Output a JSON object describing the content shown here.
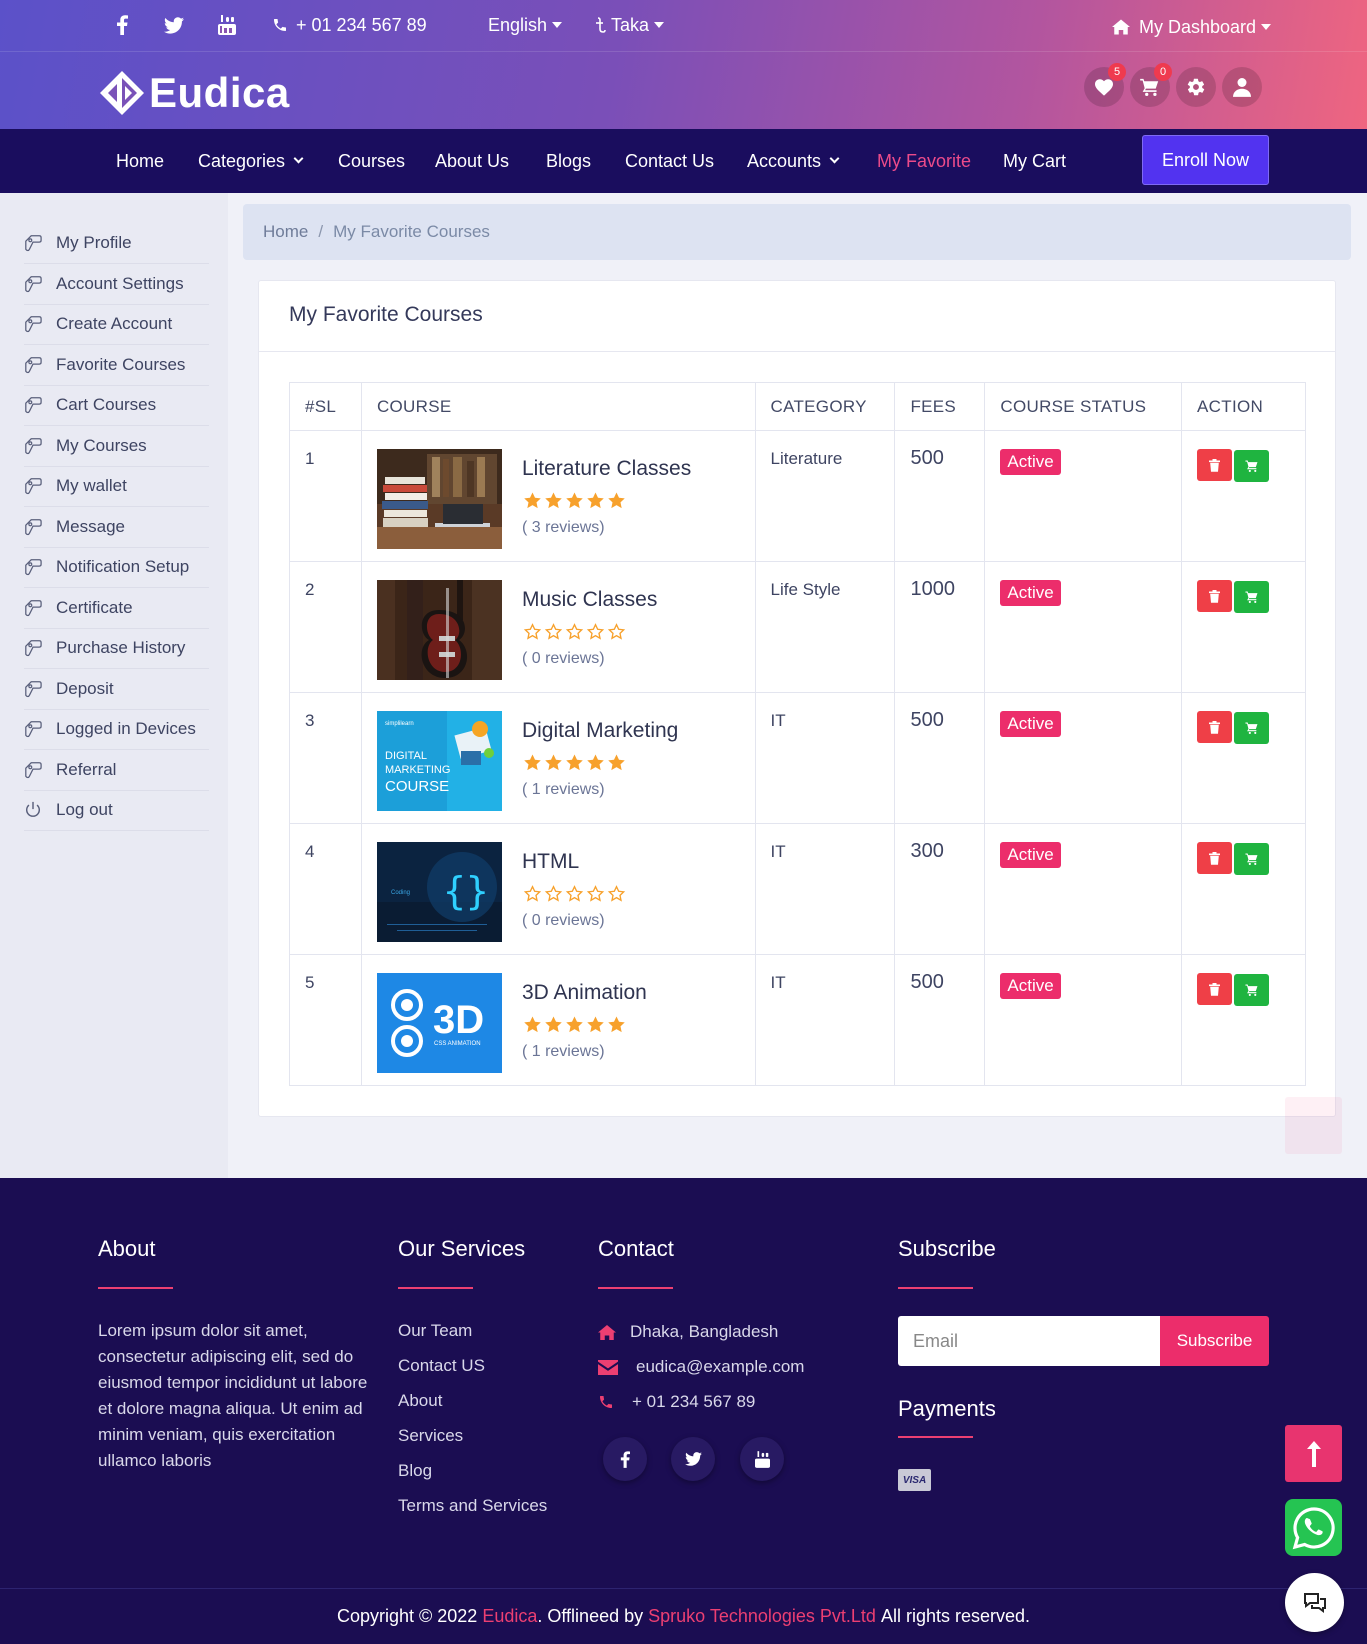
{
  "topbar": {
    "phone": "+ 01 234 567 89",
    "language": "English",
    "currency": "Taka",
    "dashboard": "My Dashboard",
    "social_icons": [
      "facebook-icon",
      "twitter-icon",
      "youtube-icon"
    ]
  },
  "header": {
    "brand": "Eudica",
    "favorites_count": "5",
    "cart_count": "0"
  },
  "nav": {
    "items": [
      "Home",
      "Categories",
      "Courses",
      "About Us",
      "Blogs",
      "Contact Us",
      "Accounts",
      "My Favorite",
      "My Cart"
    ],
    "active": "My Favorite",
    "cta": "Enroll Now"
  },
  "sidebar": {
    "items": [
      "My Profile",
      "Account Settings",
      "Create Account",
      "Favorite Courses",
      "Cart Courses",
      "My Courses",
      "My wallet",
      "Message",
      "Notification Setup",
      "Certificate",
      "Purchase History",
      "Deposit",
      "Logged in Devices",
      "Referral",
      "Log out"
    ]
  },
  "breadcrumb": {
    "home": "Home",
    "sep": "/",
    "current": "My Favorite Courses"
  },
  "card": {
    "title": "My Favorite Courses"
  },
  "table": {
    "headers": [
      "#SL",
      "COURSE",
      "CATEGORY",
      "FEES",
      "COURSE STATUS",
      "ACTION"
    ],
    "rows": [
      {
        "sl": "1",
        "course": "Literature Classes",
        "rating": 5,
        "reviews": "( 3 reviews)",
        "category": "Literature",
        "fees": "500",
        "status": "Active"
      },
      {
        "sl": "2",
        "course": "Music Classes",
        "rating": 0,
        "reviews": "( 0 reviews)",
        "category": "Life Style",
        "fees": "1000",
        "status": "Active"
      },
      {
        "sl": "3",
        "course": "Digital Marketing",
        "rating": 5,
        "reviews": "( 1 reviews)",
        "category": "IT",
        "fees": "500",
        "status": "Active"
      },
      {
        "sl": "4",
        "course": "HTML",
        "rating": 0,
        "reviews": "( 0 reviews)",
        "category": "IT",
        "fees": "300",
        "status": "Active"
      },
      {
        "sl": "5",
        "course": "3D Animation",
        "rating": 5,
        "reviews": "( 1 reviews)",
        "category": "IT",
        "fees": "500",
        "status": "Active"
      }
    ],
    "thumb_texts": {
      "digital_small": "simplilearn",
      "digital_1": "DIGITAL",
      "digital_2": "MARKETING",
      "digital_3": "COURSE",
      "html_label": "Coding",
      "anim_big": "3D",
      "anim_small": "CSS ANIMATION"
    }
  },
  "footer": {
    "about_title": "About",
    "about_text": "Lorem ipsum dolor sit amet, consectetur adipiscing elit, sed do eiusmod tempor incididunt ut labore et dolore magna aliqua. Ut enim ad minim veniam, quis exercitation ullamco laboris",
    "services_title": "Our Services",
    "services": [
      "Our Team",
      "Contact US",
      "About",
      "Services",
      "Blog",
      "Terms and Services"
    ],
    "contact_title": "Contact",
    "address": "Dhaka, Bangladesh",
    "email": "eudica@example.com",
    "phone": "+ 01 234 567 89",
    "subscribe_title": "Subscribe",
    "email_placeholder": "Email",
    "subscribe_button": "Subscribe",
    "payments_title": "Payments",
    "visa": "VISA",
    "copyright_prefix": "Copyright © 2022",
    "copyright_brand": "Eudica",
    "copyright_mid": ". Offlineed by",
    "copyright_company": "Spruko Technologies Pvt.Ltd",
    "copyright_suffix": "All rights reserved."
  },
  "colors": {
    "nav_bg": "#1a0d5e",
    "accent_pink": "#ec2d6b",
    "enroll_btn": "#5233f0",
    "star": "#f7a12c",
    "delete_btn": "#ef3f47",
    "cart_btn": "#1fb440"
  }
}
